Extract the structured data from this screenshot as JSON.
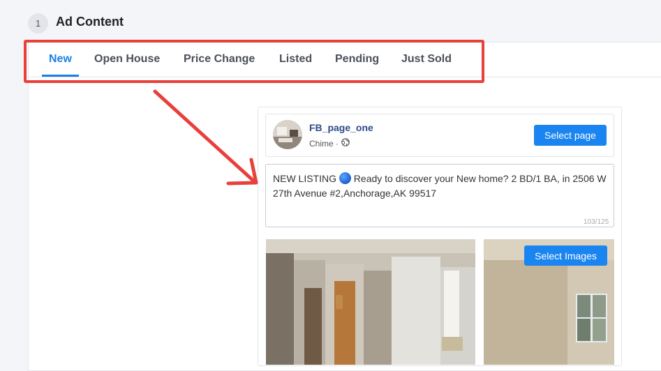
{
  "header": {
    "step_number": "1",
    "title": "Ad Content"
  },
  "tabs": [
    {
      "label": "New",
      "active": true
    },
    {
      "label": "Open House",
      "active": false
    },
    {
      "label": "Price Change",
      "active": false
    },
    {
      "label": "Listed",
      "active": false
    },
    {
      "label": "Pending",
      "active": false
    },
    {
      "label": "Just Sold",
      "active": false
    }
  ],
  "preview": {
    "page_name": "FB_page_one",
    "page_sub": "Chime ·",
    "select_page_label": "Select page",
    "ad_text_prefix": "NEW LISTING",
    "ad_text_body": "Ready to discover your New home? 2 BD/1 BA, in 2506 W 27th Avenue #2,Anchorage,AK 99517",
    "char_counter": "103/125",
    "select_images_label": "Select Images"
  },
  "colors": {
    "accent": "#1a7fe8",
    "button": "#1a85f0",
    "annotation": "#e8403a"
  },
  "icons": [
    "globe-icon",
    "blue-circle-emoji",
    "arrow-annotation"
  ]
}
